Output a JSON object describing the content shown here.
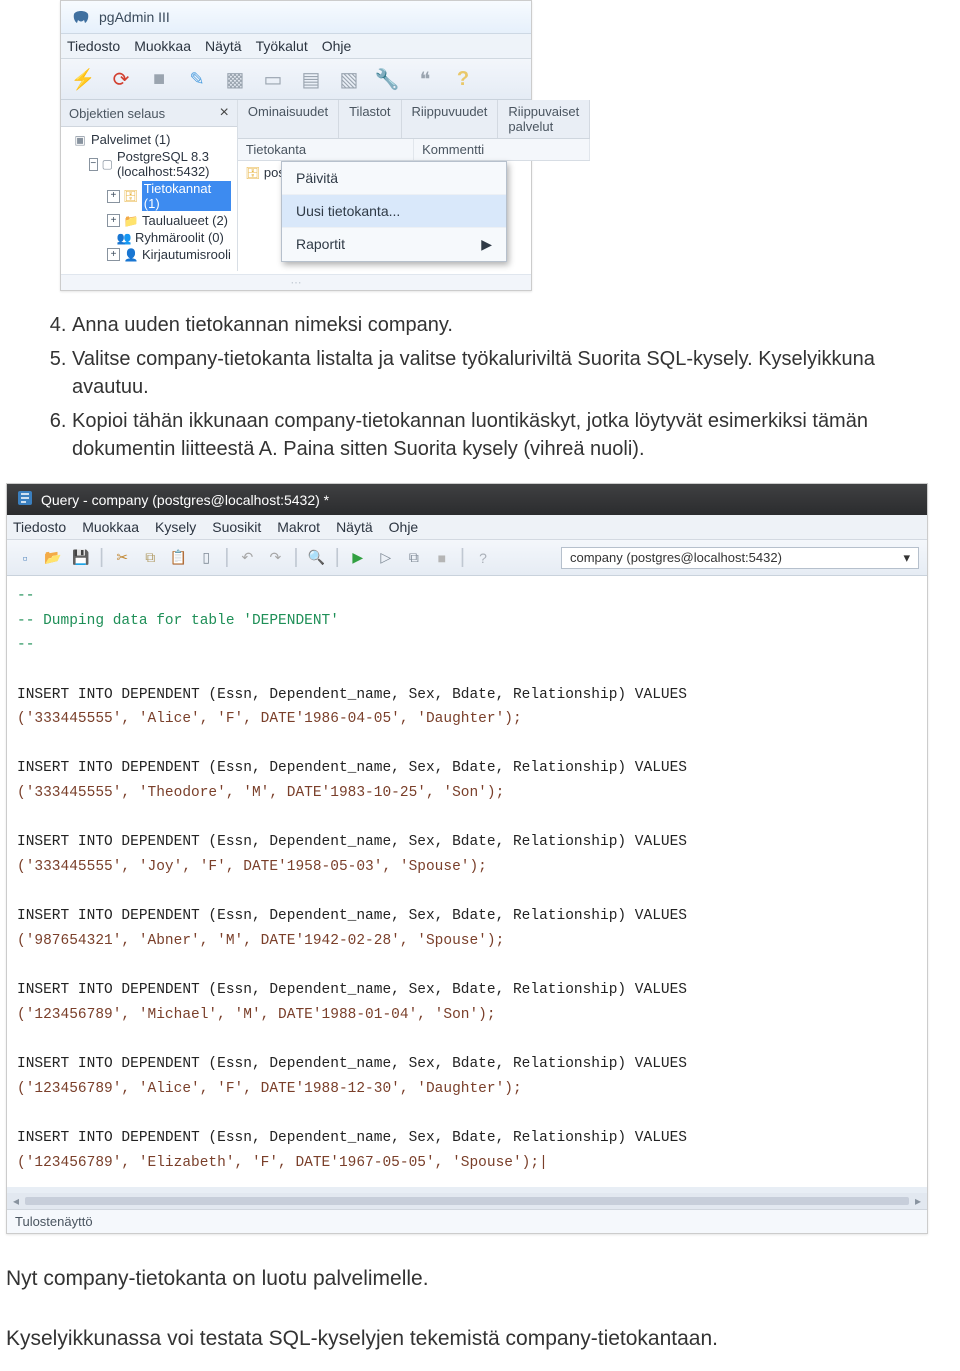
{
  "pgadmin": {
    "title": "pgAdmin III",
    "menus": [
      "Tiedosto",
      "Muokkaa",
      "Näytä",
      "Työkalut",
      "Ohje"
    ],
    "browser_header": "Objektien selaus",
    "tree": {
      "servers": "Palvelimet (1)",
      "pg": "PostgreSQL 8.3 (localhost:5432)",
      "items": [
        {
          "label": "Tietokannat (1)",
          "selected": true,
          "iconClass": "cyl"
        },
        {
          "label": "Taulualueet (2)",
          "iconClass": "tbl"
        },
        {
          "label": "Ryhmäroolit (0)",
          "iconClass": "rol"
        },
        {
          "label": "Kirjautumisrooli",
          "iconClass": "usr"
        }
      ]
    },
    "tabs": [
      "Ominaisuudet",
      "Tilastot",
      "Riippuvuudet",
      "Riippuvaiset palvelut"
    ],
    "grid_headers": [
      "Tietokanta",
      "Kommentti"
    ],
    "grid_row": "postgres",
    "ctx": {
      "refresh": "Päivitä",
      "newdb": "Uusi tietokanta...",
      "reports": "Raportit"
    }
  },
  "list": {
    "start": 4,
    "items": [
      "Anna uuden tietokannan nimeksi company.",
      "Valitse company-tietokanta listalta ja valitse työkaluriviltä Suorita SQL-kysely. Kyselyikkuna avautuu.",
      "Kopioi tähän ikkunaan company-tietokannan luontikäskyt, jotka löytyvät esimerkiksi tämän dokumentin liitteestä A. Paina sitten Suorita kysely (vihreä nuoli)."
    ]
  },
  "query": {
    "title": "Query - company (postgres@localhost:5432) *",
    "menus": [
      "Tiedosto",
      "Muokkaa",
      "Kysely",
      "Suosikit",
      "Makrot",
      "Näytä",
      "Ohje"
    ],
    "db_selector": "company (postgres@localhost:5432)",
    "output_label": "Tulostenäyttö",
    "sql_lines": [
      {
        "t": "--",
        "cls": "sql-comment"
      },
      {
        "t": "-- Dumping data for table 'DEPENDENT'",
        "cls": "sql-comment"
      },
      {
        "t": "--",
        "cls": "sql-comment"
      },
      {
        "t": ""
      },
      {
        "t": "INSERT INTO DEPENDENT (Essn, Dependent_name, Sex, Bdate, Relationship) VALUES"
      },
      {
        "t": "('333445555', 'Alice', 'F', DATE'1986-04-05', 'Daughter');",
        "cls": "sql-str"
      },
      {
        "t": ""
      },
      {
        "t": "INSERT INTO DEPENDENT (Essn, Dependent_name, Sex, Bdate, Relationship) VALUES"
      },
      {
        "t": "('333445555', 'Theodore', 'M', DATE'1983-10-25', 'Son');",
        "cls": "sql-str"
      },
      {
        "t": ""
      },
      {
        "t": "INSERT INTO DEPENDENT (Essn, Dependent_name, Sex, Bdate, Relationship) VALUES"
      },
      {
        "t": "('333445555', 'Joy', 'F', DATE'1958-05-03', 'Spouse');",
        "cls": "sql-str"
      },
      {
        "t": ""
      },
      {
        "t": "INSERT INTO DEPENDENT (Essn, Dependent_name, Sex, Bdate, Relationship) VALUES"
      },
      {
        "t": "('987654321', 'Abner', 'M', DATE'1942-02-28', 'Spouse');",
        "cls": "sql-str"
      },
      {
        "t": ""
      },
      {
        "t": "INSERT INTO DEPENDENT (Essn, Dependent_name, Sex, Bdate, Relationship) VALUES"
      },
      {
        "t": "('123456789', 'Michael', 'M', DATE'1988-01-04', 'Son');",
        "cls": "sql-str"
      },
      {
        "t": ""
      },
      {
        "t": "INSERT INTO DEPENDENT (Essn, Dependent_name, Sex, Bdate, Relationship) VALUES"
      },
      {
        "t": "('123456789', 'Alice', 'F', DATE'1988-12-30', 'Daughter');",
        "cls": "sql-str"
      },
      {
        "t": ""
      },
      {
        "t": "INSERT INTO DEPENDENT (Essn, Dependent_name, Sex, Bdate, Relationship) VALUES"
      },
      {
        "t": "('123456789', 'Elizabeth', 'F', DATE'1967-05-05', 'Spouse');|",
        "cls": "sql-str"
      }
    ]
  },
  "body_paragraphs": {
    "p1": "Nyt company-tietokanta on luotu palvelimelle.",
    "p2": "Kyselyikkunassa voi testata SQL-kyselyjen tekemistä company-tietokantaan."
  }
}
